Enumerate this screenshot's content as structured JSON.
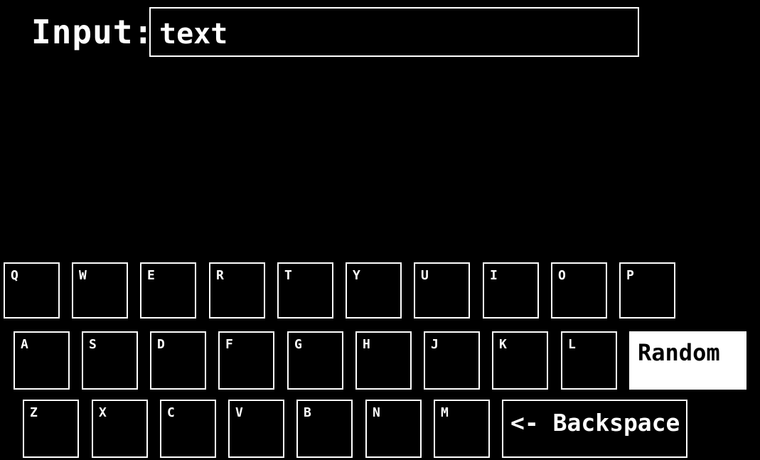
{
  "input": {
    "label": "Input:",
    "value": "text"
  },
  "keyboard": {
    "rows": [
      [
        "Q",
        "W",
        "E",
        "R",
        "T",
        "Y",
        "U",
        "I",
        "O",
        "P"
      ],
      [
        "A",
        "S",
        "D",
        "F",
        "G",
        "H",
        "J",
        "K",
        "L"
      ],
      [
        "Z",
        "X",
        "C",
        "V",
        "B",
        "N",
        "M"
      ]
    ],
    "random_label": "Random",
    "backspace_label": "<- Backspace"
  },
  "colors": {
    "background": "#000000",
    "foreground": "#ffffff",
    "highlight_fill": "#ffffff",
    "highlight_text": "#000000"
  }
}
